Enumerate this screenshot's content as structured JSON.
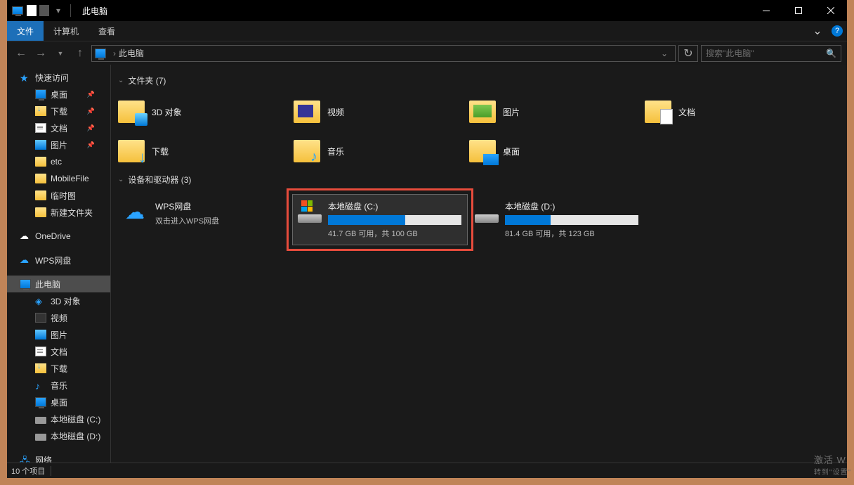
{
  "titlebar": {
    "title": "此电脑"
  },
  "ribbon": {
    "file": "文件",
    "computer": "计算机",
    "view": "查看"
  },
  "address": {
    "location": "此电脑",
    "search_placeholder": "搜索\"此电脑\""
  },
  "sidebar": {
    "quick_access": "快速访问",
    "qa_items": [
      {
        "label": "桌面",
        "icon": "monitor",
        "pin": true
      },
      {
        "label": "下载",
        "icon": "folderDL",
        "pin": true
      },
      {
        "label": "文档",
        "icon": "doc",
        "pin": true
      },
      {
        "label": "图片",
        "icon": "img",
        "pin": true
      },
      {
        "label": "etc",
        "icon": "folderY",
        "pin": false
      },
      {
        "label": "MobileFile",
        "icon": "folderY",
        "pin": false
      },
      {
        "label": "临时图",
        "icon": "folderY",
        "pin": false
      },
      {
        "label": "新建文件夹",
        "icon": "folderY",
        "pin": false
      }
    ],
    "onedrive": "OneDrive",
    "wps": "WPS网盘",
    "this_pc": "此电脑",
    "pc_items": [
      {
        "label": "3D 对象",
        "icon": "cube"
      },
      {
        "label": "视频",
        "icon": "vid"
      },
      {
        "label": "图片",
        "icon": "img"
      },
      {
        "label": "文档",
        "icon": "doc"
      },
      {
        "label": "下载",
        "icon": "folderDL"
      },
      {
        "label": "音乐",
        "icon": "music"
      },
      {
        "label": "桌面",
        "icon": "monitor"
      },
      {
        "label": "本地磁盘 (C:)",
        "icon": "drive"
      },
      {
        "label": "本地磁盘 (D:)",
        "icon": "drive"
      }
    ],
    "network": "网络"
  },
  "sections": {
    "folders_header": "文件夹 (7)",
    "drives_header": "设备和驱动器 (3)"
  },
  "folders": [
    {
      "label": "3D 对象",
      "icon": "obj"
    },
    {
      "label": "视频",
      "icon": "vid"
    },
    {
      "label": "图片",
      "icon": "img"
    },
    {
      "label": "文档",
      "icon": "doc"
    },
    {
      "label": "下载",
      "icon": "dl"
    },
    {
      "label": "音乐",
      "icon": "music"
    },
    {
      "label": "桌面",
      "icon": "desk"
    }
  ],
  "drives": {
    "wps": {
      "name": "WPS网盘",
      "sub": "双击进入WPS网盘"
    },
    "c": {
      "name": "本地磁盘 (C:)",
      "status": "41.7 GB 可用，共 100 GB",
      "fill_pct": 58
    },
    "d": {
      "name": "本地磁盘 (D:)",
      "status": "81.4 GB 可用，共 123 GB",
      "fill_pct": 34
    }
  },
  "statusbar": {
    "count": "10 个项目"
  },
  "watermark": {
    "l1": "激活 W",
    "l2": "转到\"设置\""
  }
}
